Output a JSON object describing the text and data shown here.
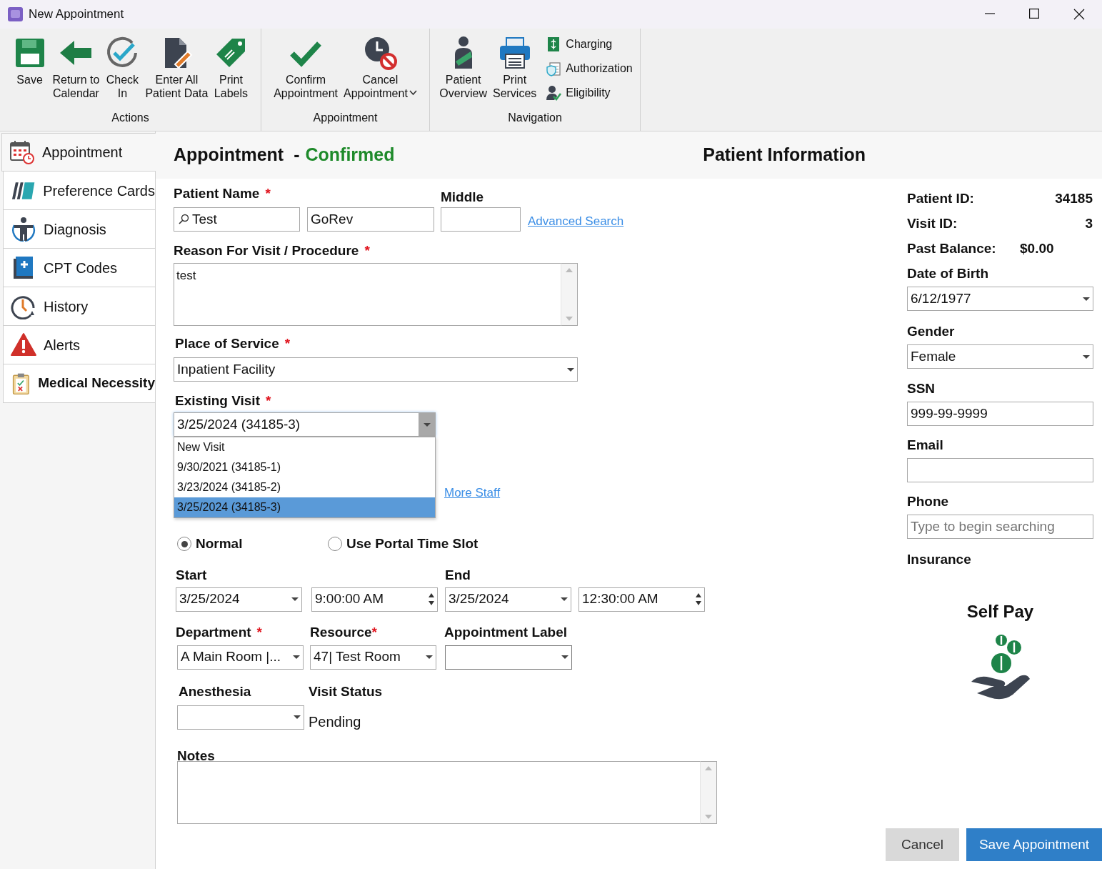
{
  "window": {
    "title": "New Appointment"
  },
  "ribbon": {
    "groups": [
      {
        "label": "Actions",
        "buttons": [
          {
            "label": "Save",
            "kind": "save"
          },
          {
            "label": "Return to\nCalendar",
            "kind": "back"
          },
          {
            "label": "Check\nIn",
            "kind": "checkin"
          },
          {
            "label": "Enter All\nPatient Data",
            "kind": "enter"
          },
          {
            "label": "Print\nLabels",
            "kind": "labels"
          }
        ]
      },
      {
        "label": "Appointment",
        "buttons": [
          {
            "label": "Confirm\nAppointment",
            "kind": "confirm"
          },
          {
            "label": "Cancel\nAppointment",
            "kind": "cancel",
            "dropdown": true
          }
        ]
      },
      {
        "label": "Navigation",
        "buttons": [
          {
            "label": "Patient\nOverview",
            "kind": "patient"
          },
          {
            "label": "Print\nServices",
            "kind": "printer"
          }
        ],
        "small_buttons": [
          {
            "label": "Charging",
            "kind": "charging"
          },
          {
            "label": "Authorization",
            "kind": "authorization"
          },
          {
            "label": "Eligibility",
            "kind": "eligibility"
          }
        ]
      }
    ]
  },
  "sidebar": {
    "items": [
      {
        "label": "Appointment",
        "kind": "calendar",
        "selected": true,
        "bold": false
      },
      {
        "label": "Preference Cards",
        "kind": "cards",
        "selected": false,
        "bold": false
      },
      {
        "label": "Diagnosis",
        "kind": "body",
        "selected": false,
        "bold": false
      },
      {
        "label": "CPT Codes",
        "kind": "book",
        "selected": false,
        "bold": false
      },
      {
        "label": "History",
        "kind": "clock",
        "selected": false,
        "bold": false
      },
      {
        "label": "Alerts",
        "kind": "alert",
        "selected": false,
        "bold": false
      },
      {
        "label": "Medical Necessity",
        "kind": "clipboard",
        "selected": false,
        "bold": true
      }
    ]
  },
  "appointment": {
    "title": "Appointment",
    "separator": "-",
    "status": "Confirmed",
    "patient_name": {
      "label": "Patient Name",
      "mark": "*",
      "first": "Test",
      "last": "GoRev"
    },
    "middle": {
      "label": "Middle"
    },
    "advanced_search": "Advanced Search",
    "reason": {
      "label": "Reason For Visit / Procedure",
      "mark": "*",
      "value": "test"
    },
    "place_of_service": {
      "label": "Place of Service",
      "mark": "*",
      "value": "Inpatient Facility"
    },
    "existing_visit": {
      "label": "Existing Visit",
      "mark": "*",
      "value": "3/25/2024 (34185-3)",
      "expanded": true,
      "options": [
        {
          "label": "New Visit",
          "selected": false
        },
        {
          "label": "9/30/2021 (34185-1)",
          "selected": false
        },
        {
          "label": "3/23/2024 (34185-2)",
          "selected": false
        },
        {
          "label": "3/25/2024 (34185-3)",
          "selected": true
        }
      ]
    },
    "more_staff": "More Staff",
    "time_mode": [
      {
        "label": "Normal",
        "selected": true
      },
      {
        "label": "Use Portal Time Slot",
        "selected": false
      }
    ],
    "start": {
      "label": "Start",
      "date": "3/25/2024",
      "time": "9:00:00 AM"
    },
    "end": {
      "label": "End",
      "date": "3/25/2024",
      "time": "12:30:00 AM"
    },
    "department": {
      "label": "Department",
      "mark": "*",
      "value": "A Main Room |..."
    },
    "resource": {
      "label": "Resource",
      "mark": "*",
      "value": "47| Test Room"
    },
    "appointment_label": {
      "label": "Appointment Label"
    },
    "anesthesia": {
      "label": "Anesthesia"
    },
    "visit_status": {
      "label": "Visit Status",
      "value": "Pending"
    },
    "notes": {
      "label": "Notes"
    }
  },
  "patient_info": {
    "title": "Patient Information",
    "facts": [
      {
        "label": "Patient ID:",
        "value": "34185"
      },
      {
        "label": "Visit ID:",
        "value": "3"
      },
      {
        "label": "Past Balance:",
        "value": "$0.00"
      }
    ],
    "date_of_birth": {
      "label": "Date of Birth",
      "value": "6/12/1977"
    },
    "gender": {
      "label": "Gender",
      "value": "Female"
    },
    "ssn": {
      "label": "SSN",
      "value": "999-99-9999"
    },
    "email": {
      "label": "Email"
    },
    "phone": {
      "label": "Phone",
      "placeholder": "Type to begin searching"
    },
    "insurance": {
      "label": "Insurance",
      "value": "Self Pay"
    }
  },
  "buttons": [
    {
      "label": "Cancel",
      "kind": "secondary"
    },
    {
      "label": "Save Appointment",
      "kind": "primary"
    }
  ]
}
